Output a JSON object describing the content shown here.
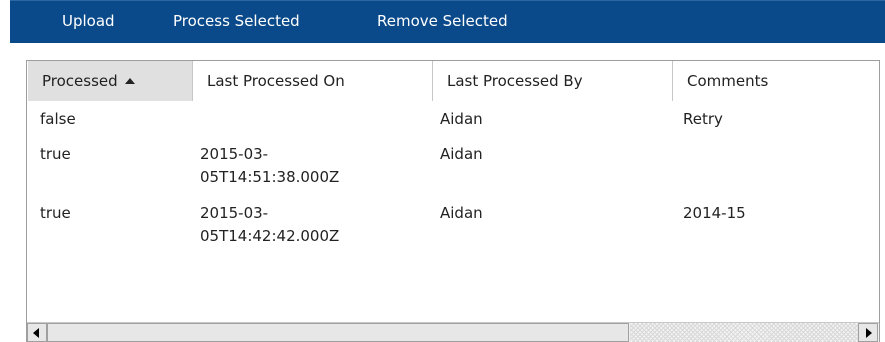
{
  "toolbar": {
    "upload_label": "Upload",
    "process_selected_label": "Process Selected",
    "remove_selected_label": "Remove Selected",
    "background_color": "#0b4a8a"
  },
  "table": {
    "columns": [
      {
        "label": "Processed",
        "sorted": "ascending"
      },
      {
        "label": "Last Processed On"
      },
      {
        "label": "Last Processed By"
      },
      {
        "label": "Comments"
      }
    ],
    "rows": [
      {
        "processed": "false",
        "last_processed_on": "",
        "last_processed_by": "Aidan",
        "comments": "Retry"
      },
      {
        "processed": "true",
        "last_processed_on": "2015-03-\n05T14:51:38.000Z",
        "last_processed_by": "Aidan",
        "comments": ""
      },
      {
        "processed": "true",
        "last_processed_on": "2015-03-\n05T14:42:42.000Z",
        "last_processed_by": "Aidan",
        "comments": "2014-15"
      }
    ]
  },
  "icons": {
    "sort": "sort-ascending-icon",
    "scroll_left": "scroll-left-icon",
    "scroll_right": "scroll-right-icon"
  }
}
